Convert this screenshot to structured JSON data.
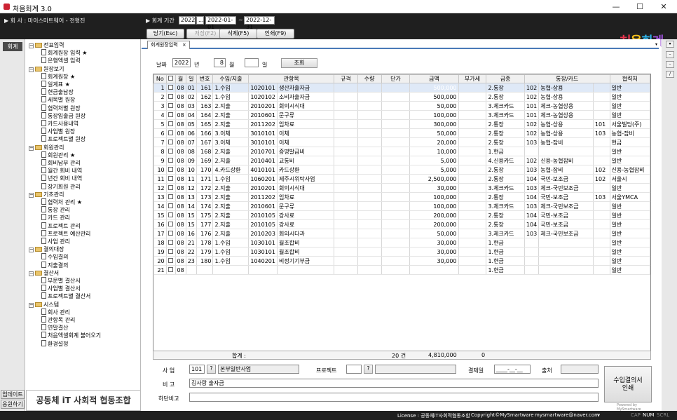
{
  "window": {
    "title": "처음회계 3.0",
    "minimize": "—",
    "maximize": "☐",
    "close": "✕"
  },
  "header": {
    "company_label": "▶ 회  사 : 마이스마트웨어 - 전형진",
    "period_label": "▶ 회계 기간",
    "year": "2022",
    "year_btn": "...",
    "date_from": "2022-01-01",
    "tilde": "~",
    "date_to": "2022-12-31",
    "btn_load": "당기(Esc)",
    "btn_save": "저장(F2)",
    "btn_delete": "삭제(F5)",
    "btn_print": "인쇄(F9)",
    "logo": "처음회계"
  },
  "left": {
    "side_tab": "회계",
    "update_btn": "업데이트",
    "help_btn": "응원하기",
    "brand": "공동체 iT 사회적 협동조합"
  },
  "tree": [
    {
      "type": "folder",
      "label": "전표입력",
      "level": 0
    },
    {
      "type": "doc",
      "label": "회계원장 입력 ★",
      "level": 1
    },
    {
      "type": "doc",
      "label": "은행엑셀 입력",
      "level": 1
    },
    {
      "type": "folder",
      "label": "원장보기",
      "level": 0
    },
    {
      "type": "doc",
      "label": "회계원장 ★",
      "level": 1
    },
    {
      "type": "doc",
      "label": "일계표 ★",
      "level": 1
    },
    {
      "type": "doc",
      "label": "현금출납장",
      "level": 1
    },
    {
      "type": "doc",
      "label": "세목별 원장",
      "level": 1
    },
    {
      "type": "doc",
      "label": "협력처별 원장",
      "level": 1
    },
    {
      "type": "doc",
      "label": "통장입출금 원장",
      "level": 1
    },
    {
      "type": "doc",
      "label": "카드사용내역",
      "level": 1
    },
    {
      "type": "doc",
      "label": "사업별 원장",
      "level": 1
    },
    {
      "type": "doc",
      "label": "프로젝트별 원장",
      "level": 1
    },
    {
      "type": "folder",
      "label": "회원관리",
      "level": 0
    },
    {
      "type": "doc",
      "label": "회원관리 ★",
      "level": 1
    },
    {
      "type": "doc",
      "label": "회비납부 관리",
      "level": 1
    },
    {
      "type": "doc",
      "label": "월간 회비 내역",
      "level": 1
    },
    {
      "type": "doc",
      "label": "년간 회비 내역",
      "level": 1
    },
    {
      "type": "doc",
      "label": "장기회원 관리",
      "level": 1
    },
    {
      "type": "folder",
      "label": "기초관리",
      "level": 0
    },
    {
      "type": "doc",
      "label": "협력처 관리 ★",
      "level": 1
    },
    {
      "type": "doc",
      "label": "통장 관리",
      "level": 1
    },
    {
      "type": "doc",
      "label": "카드 관리",
      "level": 1
    },
    {
      "type": "doc",
      "label": "프로젝트 관리",
      "level": 1
    },
    {
      "type": "doc",
      "label": "프로젝트 예산관리",
      "level": 1
    },
    {
      "type": "doc",
      "label": "사업 관리",
      "level": 1
    },
    {
      "type": "folder",
      "label": "결의대장",
      "level": 0
    },
    {
      "type": "doc",
      "label": "수입결의",
      "level": 1
    },
    {
      "type": "doc",
      "label": "지출결의",
      "level": 1
    },
    {
      "type": "folder",
      "label": "결산서",
      "level": 0
    },
    {
      "type": "doc",
      "label": "부문별 결산서",
      "level": 1
    },
    {
      "type": "doc",
      "label": "사업별 결산서",
      "level": 1
    },
    {
      "type": "doc",
      "label": "프로젝트별 결산서",
      "level": 1
    },
    {
      "type": "folder",
      "label": "시스템",
      "level": 0
    },
    {
      "type": "doc",
      "label": "회사 관리",
      "level": 1
    },
    {
      "type": "doc",
      "label": "관항목 관리",
      "level": 1
    },
    {
      "type": "doc",
      "label": "연말결산",
      "level": 1
    },
    {
      "type": "doc",
      "label": "처음엑셀회계 불어오기",
      "level": 1
    },
    {
      "type": "doc",
      "label": "환경설정",
      "level": 1
    }
  ],
  "tab": {
    "label": "회계원장입력",
    "close": "×"
  },
  "filter": {
    "date_label": "날짜",
    "year": "2022",
    "year_unit": "년",
    "month": "8",
    "month_unit": "월",
    "day": "",
    "day_unit": "일",
    "search_btn": "조회"
  },
  "grid": {
    "headers": [
      "No",
      "",
      "월",
      "일",
      "번호",
      "수입/지출",
      "관항목",
      "규격",
      "수량",
      "단가",
      "금액",
      "부가세",
      "금종",
      "통장/카드",
      "협력처"
    ],
    "rows": [
      [
        "1",
        "08",
        "01",
        "161",
        "1.수입",
        "1020101",
        "생산자출자금",
        "",
        "",
        "",
        "500,000",
        "",
        "2.통장",
        "102",
        "농협-상용",
        "",
        "일반"
      ],
      [
        "2",
        "08",
        "02",
        "162",
        "1.수입",
        "1020102",
        "소비자출자금",
        "",
        "",
        "",
        "500,000",
        "",
        "2.통장",
        "102",
        "농협-상용",
        "",
        "일반"
      ],
      [
        "3",
        "08",
        "03",
        "163",
        "2.지출",
        "2010201",
        "회의시식대",
        "",
        "",
        "",
        "50,000",
        "",
        "3.체크카드",
        "101",
        "체크-농협상용",
        "",
        "일반"
      ],
      [
        "4",
        "08",
        "04",
        "164",
        "2.지출",
        "2010601",
        "문구류",
        "",
        "",
        "",
        "100,000",
        "",
        "3.체크카드",
        "101",
        "체크-농협상용",
        "",
        "일반"
      ],
      [
        "5",
        "08",
        "05",
        "165",
        "2.지출",
        "2011202",
        "임차료",
        "",
        "",
        "",
        "300,000",
        "",
        "2.통장",
        "102",
        "농협-상용",
        "101",
        "서울빌딩(주)"
      ],
      [
        "6",
        "08",
        "06",
        "166",
        "3.이체",
        "3010101",
        "이체",
        "",
        "",
        "",
        "50,000",
        "",
        "2.통장",
        "102",
        "농협-상용",
        "103",
        "농협-잡비"
      ],
      [
        "7",
        "08",
        "07",
        "167",
        "3.이체",
        "3010101",
        "이체",
        "",
        "",
        "",
        "20,000",
        "",
        "2.통장",
        "103",
        "농협-잡비",
        "",
        "현금"
      ],
      [
        "8",
        "08",
        "08",
        "168",
        "2.지출",
        "2010701",
        "증명발급비",
        "",
        "",
        "",
        "10,000",
        "",
        "1.현금",
        "",
        "",
        "",
        "일반"
      ],
      [
        "9",
        "08",
        "09",
        "169",
        "2.지출",
        "2010401",
        "교통비",
        "",
        "",
        "",
        "5,000",
        "",
        "4.신용카드",
        "102",
        "신용-농협잡비",
        "",
        "일반"
      ],
      [
        "10",
        "08",
        "10",
        "170",
        "4.카드상환",
        "4010101",
        "카드상환",
        "",
        "",
        "",
        "5,000",
        "",
        "2.통장",
        "103",
        "농협-잡비",
        "102",
        "신용-농협잡비"
      ],
      [
        "11",
        "08",
        "11",
        "171",
        "1.수입",
        "1060201",
        "제주시위탁사업",
        "",
        "",
        "",
        "2,500,000",
        "",
        "2.통장",
        "104",
        "국민-보조금",
        "102",
        "서울시"
      ],
      [
        "12",
        "08",
        "12",
        "172",
        "2.지출",
        "2010201",
        "회의시식대",
        "",
        "",
        "",
        "30,000",
        "",
        "3.체크카드",
        "103",
        "체크-국민보조금",
        "",
        "일반"
      ],
      [
        "13",
        "08",
        "13",
        "173",
        "2.지출",
        "2011202",
        "임차료",
        "",
        "",
        "",
        "100,000",
        "",
        "2.통장",
        "104",
        "국민-보조금",
        "103",
        "서울YMCA"
      ],
      [
        "14",
        "08",
        "14",
        "174",
        "2.지출",
        "2010601",
        "문구류",
        "",
        "",
        "",
        "100,000",
        "",
        "3.체크카드",
        "103",
        "체크-국민보조금",
        "",
        "일반"
      ],
      [
        "15",
        "08",
        "15",
        "175",
        "2.지출",
        "2010105",
        "강사료",
        "",
        "",
        "",
        "200,000",
        "",
        "2.통장",
        "104",
        "국민-보조금",
        "",
        "일반"
      ],
      [
        "16",
        "08",
        "15",
        "177",
        "2.지출",
        "2010105",
        "강사료",
        "",
        "",
        "",
        "200,000",
        "",
        "2.통장",
        "104",
        "국민-보조금",
        "",
        "일반"
      ],
      [
        "17",
        "08",
        "16",
        "176",
        "2.지출",
        "2010203",
        "회의시다과",
        "",
        "",
        "",
        "50,000",
        "",
        "3.체크카드",
        "103",
        "체크-국민보조금",
        "",
        "일반"
      ],
      [
        "18",
        "08",
        "21",
        "178",
        "1.수입",
        "1030101",
        "월조합비",
        "",
        "",
        "",
        "30,000",
        "",
        "1.현금",
        "",
        "",
        "",
        "일반"
      ],
      [
        "19",
        "08",
        "22",
        "179",
        "1.수입",
        "1030101",
        "월조합비",
        "",
        "",
        "",
        "30,000",
        "",
        "1.현금",
        "",
        "",
        "",
        "일반"
      ],
      [
        "20",
        "08",
        "23",
        "180",
        "1.수입",
        "1040201",
        "비정기기부금",
        "",
        "",
        "",
        "30,000",
        "",
        "1.현금",
        "",
        "",
        "",
        "일반"
      ],
      [
        "21",
        "08",
        "",
        "",
        "",
        "",
        "",
        "",
        "",
        "",
        "",
        "",
        "1.현금",
        "",
        "",
        "",
        "일반"
      ]
    ],
    "total_label": "합계 :",
    "total_count": "20 건",
    "total_amount": "4,810,000",
    "total_vat": "0"
  },
  "detail": {
    "biz_label": "사  업",
    "biz_code": "101",
    "q1": "?",
    "biz_name": "본부일반사업",
    "project_label": "프로젝트",
    "q2": "?",
    "approve_label": "결제일",
    "approve_value": "____-__-__",
    "source_label": "출처",
    "memo_label": "비  고",
    "memo_value": "김사랑 출자금",
    "memo2_label": "하단비고",
    "print_btn": "수입결의서\n인쇄",
    "powered": "Powered by MySmartware"
  },
  "status": {
    "license": "License : 공동체iT사회적협동조합",
    "copyright": "Copyright©MySmartware",
    "email": "mysmartware@naver.com",
    "v": "v",
    "cap": "CAP",
    "num": "NUM",
    "scrl": "SCRL"
  },
  "colors": {
    "accent": "#3a6fd8",
    "header": "#1f1f1f",
    "selected_row": "#dfe9f7"
  }
}
